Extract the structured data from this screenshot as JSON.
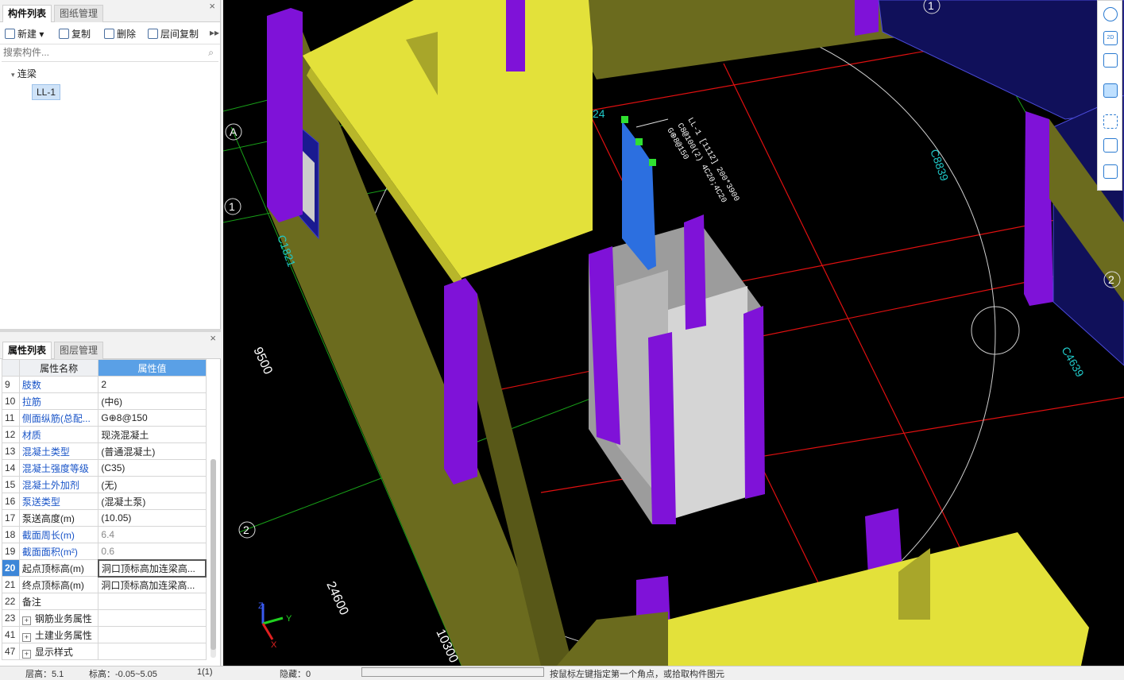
{
  "component_panel": {
    "tabs": [
      "构件列表",
      "图纸管理"
    ],
    "toolbar": {
      "new": "新建",
      "copy": "复制",
      "delete": "删除",
      "floor_copy": "层间复制"
    },
    "search_placeholder": "搜索构件...",
    "tree": {
      "group": "连梁",
      "item": "LL-1"
    }
  },
  "property_panel": {
    "tabs": [
      "属性列表",
      "图层管理"
    ],
    "headers": {
      "name": "属性名称",
      "value": "属性值"
    },
    "rows": [
      {
        "n": "9",
        "k": "肢数",
        "v": "2"
      },
      {
        "n": "10",
        "k": "拉筋",
        "v": "(中6)"
      },
      {
        "n": "11",
        "k": "侧面纵筋(总配...",
        "v": "G⊕8@150"
      },
      {
        "n": "12",
        "k": "材质",
        "v": "现浇混凝土"
      },
      {
        "n": "13",
        "k": "混凝土类型",
        "v": "(普通混凝土)"
      },
      {
        "n": "14",
        "k": "混凝土强度等级",
        "v": "(C35)"
      },
      {
        "n": "15",
        "k": "混凝土外加剂",
        "v": "(无)"
      },
      {
        "n": "16",
        "k": "泵送类型",
        "v": "(混凝土泵)"
      },
      {
        "n": "17",
        "k": "泵送高度(m)",
        "v": "(10.05)"
      },
      {
        "n": "18",
        "k": "截面周长(m)",
        "v": "6.4"
      },
      {
        "n": "19",
        "k": "截面面积(m²)",
        "v": "0.6"
      },
      {
        "n": "20",
        "k": "起点顶标高(m)",
        "v": "洞口顶标高加连梁高..."
      },
      {
        "n": "21",
        "k": "终点顶标高(m)",
        "v": "洞口顶标高加连梁高..."
      },
      {
        "n": "22",
        "k": "备注",
        "v": ""
      },
      {
        "n": "23",
        "k": "钢筋业务属性",
        "v": ""
      },
      {
        "n": "41",
        "k": "土建业务属性",
        "v": ""
      },
      {
        "n": "47",
        "k": "显示样式",
        "v": ""
      }
    ]
  },
  "canvas": {
    "axis_labels": [
      "A",
      "1",
      "2",
      "1",
      "2"
    ],
    "dimensions": [
      "9500",
      "24600",
      "10300"
    ],
    "window_labels": [
      "C1821",
      "C8839",
      "C4639",
      "24"
    ],
    "beam_annotation": [
      "LL-1 [1112] 200*3900",
      "C8@100(2) 4C20;4C20",
      "G⊕8@150"
    ],
    "axes": {
      "x": "X",
      "y": "Y",
      "z": "Z"
    }
  },
  "status_bar": {
    "floor": "层高：5.1",
    "elev": "标高：-0.05~5.05",
    "count": "1(1)",
    "hidden": "隐藏：0",
    "hint": "按鼠标左键指定第一个角点，或拾取构件图元"
  },
  "colors": {
    "accent": "#3c86d8",
    "wall": "#6b6b1e",
    "slab": "#e3e13a",
    "column": "#7f12d8",
    "beam": "#2c6fe0",
    "grid_red": "#e01010",
    "grid_green": "#18a018"
  }
}
